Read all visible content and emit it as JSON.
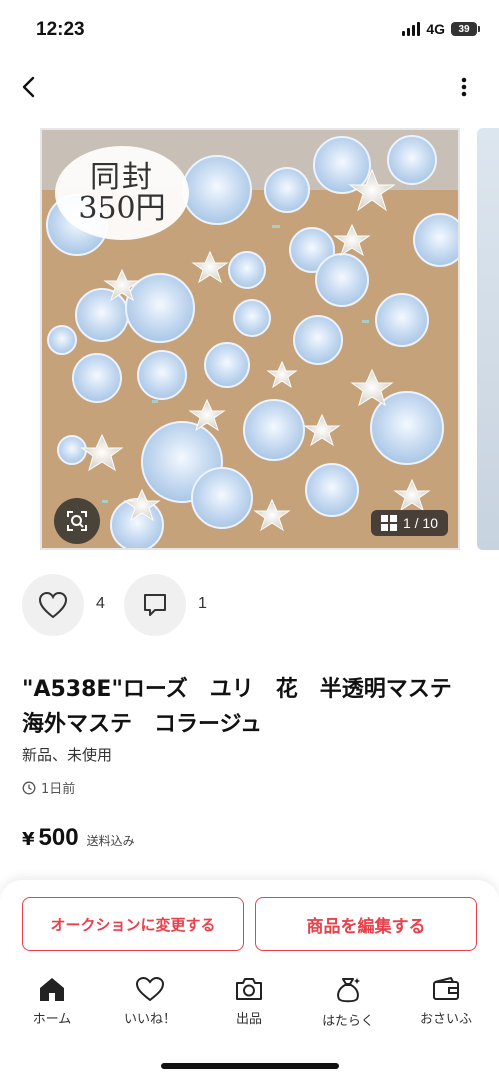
{
  "status_bar": {
    "time": "12:23",
    "network": "4G",
    "battery": "39"
  },
  "product": {
    "image_tag_line1": "同封",
    "image_tag_line2": "350円",
    "image_counter": "1 / 10",
    "likes": "4",
    "comments": "1",
    "title": "\"A538E\"ローズ　ユリ　花　半透明マステ　海外マステ　コラージュ",
    "condition": "新品、未使用",
    "posted": "1日前",
    "currency": "¥",
    "price": "500",
    "shipping": "送料込み"
  },
  "actions": {
    "auction_label": "オークションに変更する",
    "edit_label": "商品を編集する"
  },
  "tabbar": {
    "home": "ホーム",
    "likes": "いいね！",
    "sell": "出品",
    "work": "はたらく",
    "wallet": "おさいふ"
  },
  "colors": {
    "accent": "#e8414b",
    "text": "#111111"
  },
  "icons": [
    "back-arrow-icon",
    "more-vertical-icon",
    "lens-search-icon",
    "gallery-grid-icon",
    "heart-icon",
    "comment-icon",
    "clock-icon",
    "home-icon",
    "heart-outline-icon",
    "camera-icon",
    "money-bag-icon",
    "wallet-icon"
  ]
}
